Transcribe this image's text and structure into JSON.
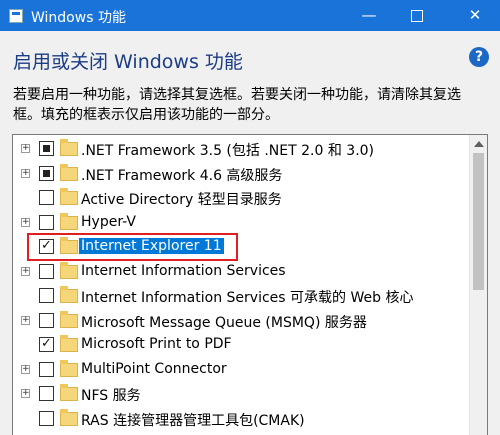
{
  "window": {
    "title": "Windows 功能",
    "minimize": "—",
    "close": "✕"
  },
  "heading": "启用或关闭 Windows 功能",
  "help_glyph": "?",
  "description": [
    "若要启用一种功能，请选择其复选框。若要关闭一种功能，请清除其复选",
    "框。填充的框表示仅启用该功能的一部分。"
  ],
  "features": [
    {
      "label": ".NET Framework 3.5 (包括 .NET 2.0 和 3.0)",
      "expandable": true,
      "state": "partial",
      "selected": false
    },
    {
      "label": ".NET Framework 4.6 高级服务",
      "expandable": true,
      "state": "partial",
      "selected": false
    },
    {
      "label": "Active Directory 轻型目录服务",
      "expandable": false,
      "state": "unchecked",
      "selected": false
    },
    {
      "label": "Hyper-V",
      "expandable": true,
      "state": "unchecked",
      "selected": false
    },
    {
      "label": "Internet Explorer 11",
      "expandable": false,
      "state": "checked",
      "selected": true
    },
    {
      "label": "Internet Information Services",
      "expandable": true,
      "state": "unchecked",
      "selected": false
    },
    {
      "label": "Internet Information Services 可承载的 Web 核心",
      "expandable": false,
      "state": "unchecked",
      "selected": false
    },
    {
      "label": "Microsoft Message Queue (MSMQ) 服务器",
      "expandable": true,
      "state": "unchecked",
      "selected": false
    },
    {
      "label": "Microsoft Print to PDF",
      "expandable": false,
      "state": "checked",
      "selected": false
    },
    {
      "label": "MultiPoint Connector",
      "expandable": true,
      "state": "unchecked",
      "selected": false
    },
    {
      "label": "NFS 服务",
      "expandable": true,
      "state": "unchecked",
      "selected": false
    },
    {
      "label": "RAS 连接管理器管理工具包(CMAK)",
      "expandable": false,
      "state": "unchecked",
      "selected": false
    }
  ],
  "colors": {
    "titlebar": "#1a73d9",
    "selection": "#0078d7",
    "annotation": "#e02020",
    "heading": "#1b3c86"
  },
  "icons": {
    "app": "windows-features-icon",
    "help": "help-icon",
    "feature": "folder-icon"
  }
}
